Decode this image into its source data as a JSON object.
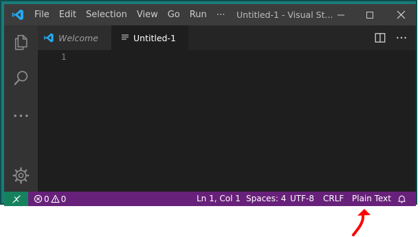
{
  "titlebar": {
    "menu": [
      "File",
      "Edit",
      "Selection",
      "View",
      "Go",
      "Run",
      "⋯"
    ],
    "window_title": "Untitled-1 - Visual St..."
  },
  "tabs": [
    {
      "label": "Welcome",
      "active": false,
      "italic": true
    },
    {
      "label": "Untitled-1",
      "active": true
    }
  ],
  "editor": {
    "line_numbers": [
      "1"
    ]
  },
  "statusbar": {
    "errors": "0",
    "warnings": "0",
    "position": "Ln 1, Col 1",
    "spaces": "Spaces: 4",
    "encoding": "UTF-8",
    "eol": "CRLF",
    "language": "Plain Text"
  },
  "colors": {
    "frame": "#1b7c7a",
    "titlebar": "#3c3c3c",
    "activitybar": "#333333",
    "editor": "#1e1e1e",
    "statusbar": "#68217a",
    "remote": "#16825d",
    "vscode_blue": "#23a9f2",
    "annotation_arrow": "#ff0000"
  },
  "icons": [
    "vscode-logo",
    "explorer-icon",
    "search-icon",
    "more-icon",
    "settings-gear-icon",
    "split-editor-icon",
    "more-actions-icon",
    "remote-icon",
    "error-icon",
    "warning-icon",
    "bell-icon",
    "minimize-icon",
    "maximize-icon",
    "close-icon"
  ]
}
